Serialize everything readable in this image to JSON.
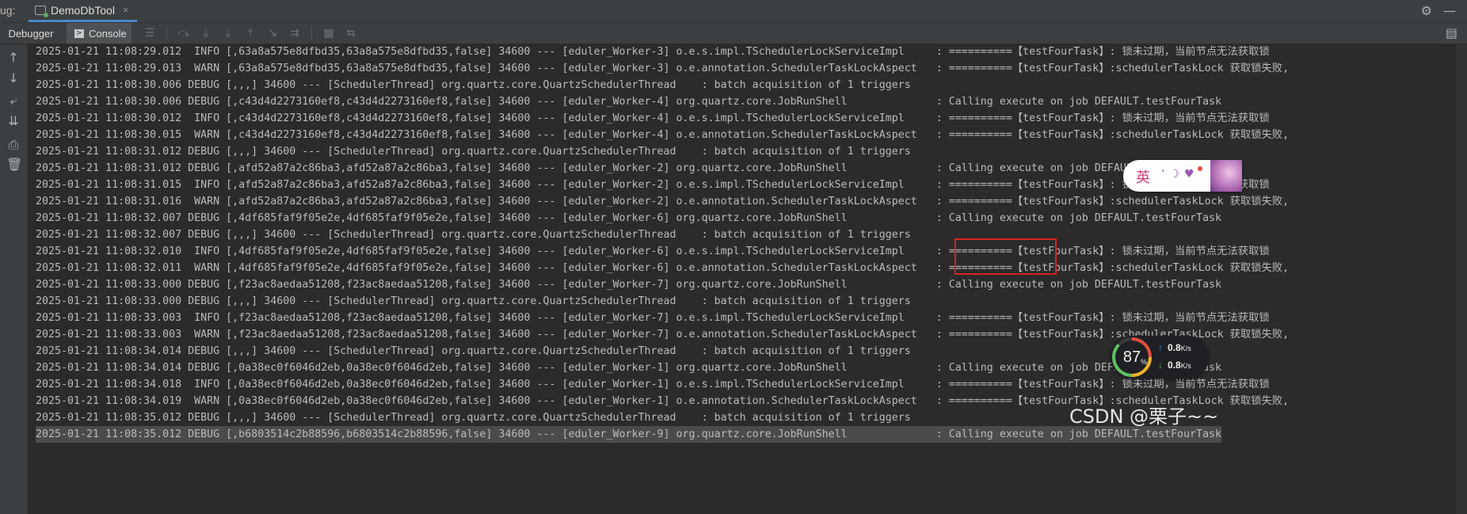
{
  "debug_label": "ug:",
  "tab": {
    "title": "DemoDbTool",
    "close": "×"
  },
  "toolbar": {
    "tabs": [
      {
        "label": "Debugger"
      },
      {
        "label": "Console"
      }
    ],
    "icons": [
      "menu-icon",
      "step-over-icon",
      "step-into-icon",
      "force-step-into-icon",
      "step-out-icon",
      "run-to-cursor-icon",
      "evaluate-icon",
      "table-icon",
      "restore-layout-icon"
    ]
  },
  "log_lines": [
    "2025-01-21 11:08:29.012  INFO [,63a8a575e8dfbd35,63a8a575e8dfbd35,false] 34600 --- [eduler_Worker-3] o.e.s.impl.TSchedulerLockServiceImpl     : ==========【testFourTask】: 锁未过期，当前节点无法获取锁",
    "2025-01-21 11:08:29.013  WARN [,63a8a575e8dfbd35,63a8a575e8dfbd35,false] 34600 --- [eduler_Worker-3] o.e.annotation.SchedulerTaskLockAspect   : ==========【testFourTask】:schedulerTaskLock 获取锁失败,",
    "2025-01-21 11:08:30.006 DEBUG [,,,] 34600 --- [SchedulerThread] org.quartz.core.QuartzSchedulerThread    : batch acquisition of 1 triggers",
    "2025-01-21 11:08:30.006 DEBUG [,c43d4d2273160ef8,c43d4d2273160ef8,false] 34600 --- [eduler_Worker-4] org.quartz.core.JobRunShell              : Calling execute on job DEFAULT.testFourTask",
    "2025-01-21 11:08:30.012  INFO [,c43d4d2273160ef8,c43d4d2273160ef8,false] 34600 --- [eduler_Worker-4] o.e.s.impl.TSchedulerLockServiceImpl     : ==========【testFourTask】: 锁未过期，当前节点无法获取锁",
    "2025-01-21 11:08:30.015  WARN [,c43d4d2273160ef8,c43d4d2273160ef8,false] 34600 --- [eduler_Worker-4] o.e.annotation.SchedulerTaskLockAspect   : ==========【testFourTask】:schedulerTaskLock 获取锁失败,",
    "2025-01-21 11:08:31.012 DEBUG [,,,] 34600 --- [SchedulerThread] org.quartz.core.QuartzSchedulerThread    : batch acquisition of 1 triggers",
    "2025-01-21 11:08:31.012 DEBUG [,afd52a87a2c86ba3,afd52a87a2c86ba3,false] 34600 --- [eduler_Worker-2] org.quartz.core.JobRunShell              : Calling execute on job DEFAULT.testFourTask",
    "2025-01-21 11:08:31.015  INFO [,afd52a87a2c86ba3,afd52a87a2c86ba3,false] 34600 --- [eduler_Worker-2] o.e.s.impl.TSchedulerLockServiceImpl     : ==========【testFourTask】: 锁未过期，当前节点无法获取锁",
    "2025-01-21 11:08:31.016  WARN [,afd52a87a2c86ba3,afd52a87a2c86ba3,false] 34600 --- [eduler_Worker-2] o.e.annotation.SchedulerTaskLockAspect   : ==========【testFourTask】:schedulerTaskLock 获取锁失败,",
    "2025-01-21 11:08:32.007 DEBUG [,4df685faf9f05e2e,4df685faf9f05e2e,false] 34600 --- [eduler_Worker-6] org.quartz.core.JobRunShell              : Calling execute on job DEFAULT.testFourTask",
    "2025-01-21 11:08:32.007 DEBUG [,,,] 34600 --- [SchedulerThread] org.quartz.core.QuartzSchedulerThread    : batch acquisition of 1 triggers",
    "2025-01-21 11:08:32.010  INFO [,4df685faf9f05e2e,4df685faf9f05e2e,false] 34600 --- [eduler_Worker-6] o.e.s.impl.TSchedulerLockServiceImpl     : ==========【testFourTask】: 锁未过期，当前节点无法获取锁",
    "2025-01-21 11:08:32.011  WARN [,4df685faf9f05e2e,4df685faf9f05e2e,false] 34600 --- [eduler_Worker-6] o.e.annotation.SchedulerTaskLockAspect   : ==========【testFourTask】:schedulerTaskLock 获取锁失败,",
    "2025-01-21 11:08:33.000 DEBUG [,f23ac8aedaa51208,f23ac8aedaa51208,false] 34600 --- [eduler_Worker-7] org.quartz.core.JobRunShell              : Calling execute on job DEFAULT.testFourTask",
    "2025-01-21 11:08:33.000 DEBUG [,,,] 34600 --- [SchedulerThread] org.quartz.core.QuartzSchedulerThread    : batch acquisition of 1 triggers",
    "2025-01-21 11:08:33.003  INFO [,f23ac8aedaa51208,f23ac8aedaa51208,false] 34600 --- [eduler_Worker-7] o.e.s.impl.TSchedulerLockServiceImpl     : ==========【testFourTask】: 锁未过期，当前节点无法获取锁",
    "2025-01-21 11:08:33.003  WARN [,f23ac8aedaa51208,f23ac8aedaa51208,false] 34600 --- [eduler_Worker-7] o.e.annotation.SchedulerTaskLockAspect   : ==========【testFourTask】:schedulerTaskLock 获取锁失败,",
    "2025-01-21 11:08:34.014 DEBUG [,,,] 34600 --- [SchedulerThread] org.quartz.core.QuartzSchedulerThread    : batch acquisition of 1 triggers",
    "2025-01-21 11:08:34.014 DEBUG [,0a38ec0f6046d2eb,0a38ec0f6046d2eb,false] 34600 --- [eduler_Worker-1] org.quartz.core.JobRunShell              : Calling execute on job DEFAULT.testFourTask",
    "2025-01-21 11:08:34.018  INFO [,0a38ec0f6046d2eb,0a38ec0f6046d2eb,false] 34600 --- [eduler_Worker-1] o.e.s.impl.TSchedulerLockServiceImpl     : ==========【testFourTask】: 锁未过期，当前节点无法获取锁",
    "2025-01-21 11:08:34.019  WARN [,0a38ec0f6046d2eb,0a38ec0f6046d2eb,false] 34600 --- [eduler_Worker-1] o.e.annotation.SchedulerTaskLockAspect   : ==========【testFourTask】:schedulerTaskLock 获取锁失败,",
    "2025-01-21 11:08:35.012 DEBUG [,,,] 34600 --- [SchedulerThread] org.quartz.core.QuartzSchedulerThread    : batch acquisition of 1 triggers",
    "2025-01-21 11:08:35.012 DEBUG [,b6803514c2b88596,b6803514c2b88596,false] 34600 --- [eduler_Worker-9] org.quartz.core.JobRunShell              : Calling execute on job DEFAULT.testFourTask"
  ],
  "ime": {
    "label": "英"
  },
  "net_widget": {
    "percent": "87",
    "percent_unit": "%",
    "up": "0.8",
    "down": "0.8",
    "unit": "K/s",
    "ring_colors": [
      "#e34f3f",
      "#f0b429",
      "#5fbf5f"
    ]
  },
  "watermark": "CSDN @栗子~~",
  "colors": {
    "highlight_box": "#d9231f",
    "accent": "#4a88c7"
  }
}
